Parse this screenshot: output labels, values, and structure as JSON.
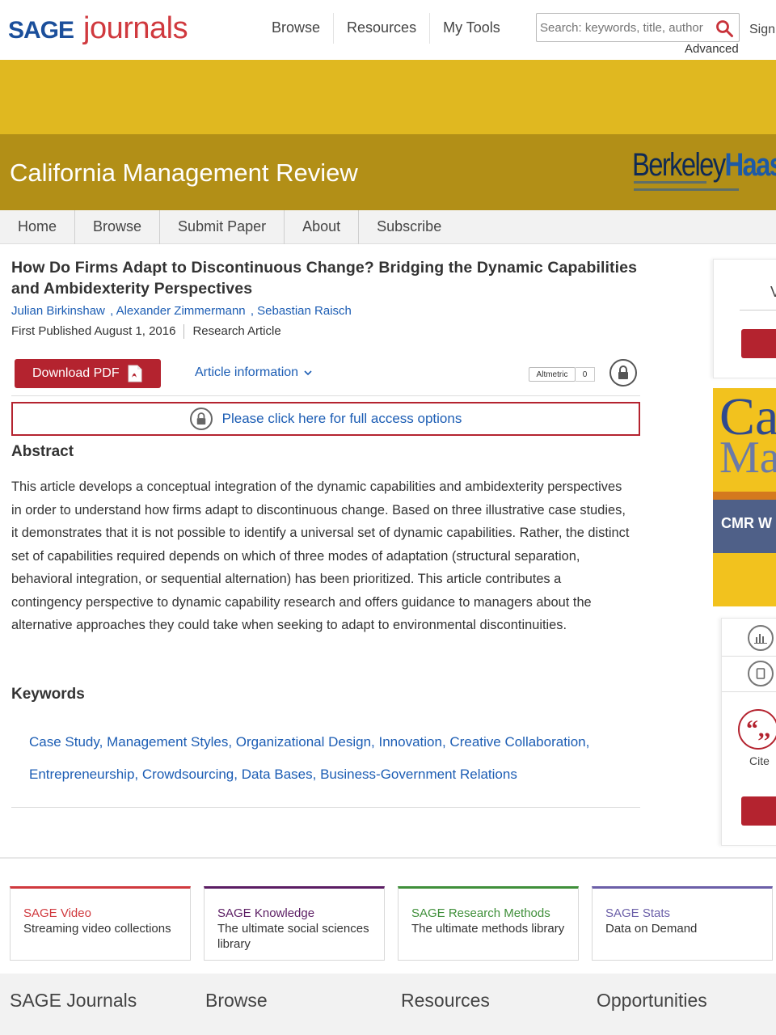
{
  "header": {
    "logo_sage": "SAGE",
    "logo_journals": "journals",
    "nav": [
      "Browse",
      "Resources",
      "My Tools"
    ],
    "search_placeholder": "Search: keywords, title, author",
    "advanced": "Advanced",
    "sign_in": "Sign"
  },
  "banner": {
    "journal_title": "California Management Review",
    "partner_logo_part1": "Berkeley",
    "partner_logo_part2": "Haas",
    "colors": {
      "top": "#e0b820",
      "main": "#b28f17"
    }
  },
  "journal_nav": [
    "Home",
    "Browse",
    "Submit Paper",
    "About",
    "Subscribe"
  ],
  "article": {
    "title": "How Do Firms Adapt to Discontinuous Change? Bridging the Dynamic Capabilities and Ambidexterity Perspectives",
    "authors": [
      "Julian Birkinshaw",
      ", Alexander Zimmermann",
      ", Sebastian Raisch"
    ],
    "first_published": "First Published August 1, 2016",
    "article_type": "Research Article",
    "download_label": "Download PDF",
    "article_info_label": "Article information",
    "altmetric_label": "Altmetric",
    "altmetric_count": "0",
    "access_text": "Please click here for full access options",
    "abstract_heading": "Abstract",
    "abstract": "This article develops a conceptual integration of the dynamic capabilities and ambidexterity perspectives in order to understand how firms adapt to discontinuous change. Based on three illustrative case studies, it demonstrates that it is not possible to identify a universal set of dynamic capabilities. Rather, the distinct set of capabilities required depends on which of three modes of adaptation (structural separation, behavioral integration, or sequential alternation) has been prioritized. This article contributes a contingency perspective to dynamic capability research and offers guidance to managers about the alternative approaches they could take when seeking to adapt to environmental discontinuities.",
    "keywords_heading": "Keywords",
    "keywords": [
      "Case Study,",
      "Management Styles,",
      "Organizational Design,",
      "Innovation,",
      "Creative Collaboration,",
      "Entrepreneurship,",
      "Crowdsourcing,",
      "Data Bases,",
      "Business-Government Relations"
    ]
  },
  "sidebar": {
    "card1_letter": "V",
    "promo_big1": "Ca",
    "promo_big2": "Ma",
    "promo_label": "CMR W",
    "cite_glyph": "“,,",
    "cite_label": "Cite"
  },
  "products": [
    {
      "name": "SAGE Video",
      "desc": "Streaming video collections",
      "color": "#d0393e"
    },
    {
      "name": "SAGE Knowledge",
      "desc": "The ultimate social sciences library",
      "color": "#5b1d63"
    },
    {
      "name": "SAGE Research Methods",
      "desc": "The ultimate methods library",
      "color": "#3f8f3a"
    },
    {
      "name": "SAGE Stats",
      "desc": "Data on Demand",
      "color": "#6b5fa8"
    }
  ],
  "footer": [
    "SAGE Journals",
    "Browse",
    "Resources",
    "Opportunities"
  ],
  "accent_colors": {
    "link": "#1c5db4",
    "red": "#b4232f"
  }
}
